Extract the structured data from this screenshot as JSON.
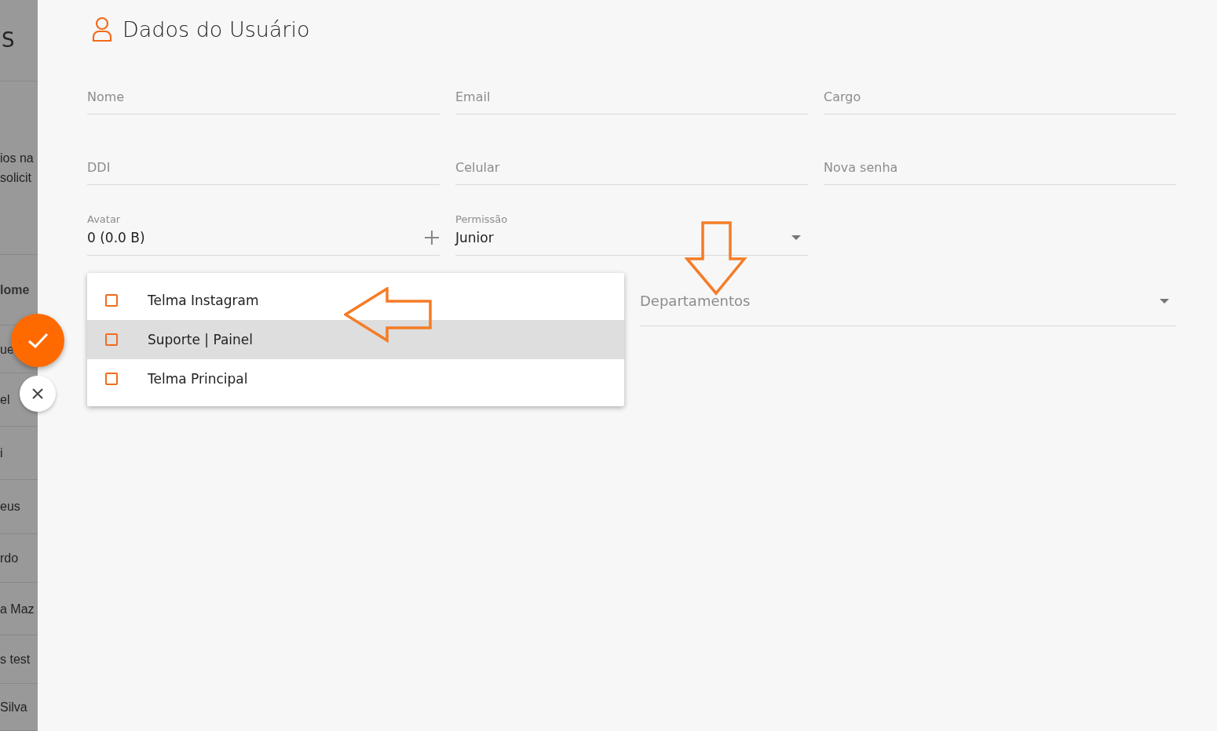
{
  "sidebar": {
    "header": "S",
    "rows": [
      {
        "lines": [
          "ios na",
          "solicit"
        ],
        "bold": false
      },
      {
        "lines": [
          "lome"
        ],
        "bold": true
      },
      {
        "lines": [
          "ue"
        ],
        "bold": false
      },
      {
        "lines": [
          "el"
        ],
        "bold": false
      },
      {
        "lines": [
          "i"
        ],
        "bold": false
      },
      {
        "lines": [
          "eus"
        ],
        "bold": false
      },
      {
        "lines": [
          "rdo"
        ],
        "bold": false
      },
      {
        "lines": [
          "a Maz"
        ],
        "bold": false
      },
      {
        "lines": [
          "s test"
        ],
        "bold": false
      },
      {
        "lines": [
          "Silva"
        ],
        "bold": false
      }
    ]
  },
  "title": "Dados do Usuário",
  "fields": [
    {
      "kind": "text",
      "label": "Nome"
    },
    {
      "kind": "text",
      "label": "Email"
    },
    {
      "kind": "text",
      "label": "Cargo"
    },
    {
      "kind": "text",
      "label": "DDI"
    },
    {
      "kind": "text",
      "label": "Celular"
    },
    {
      "kind": "text",
      "label": "Nova senha"
    },
    {
      "kind": "file",
      "label": "Avatar",
      "value": "0 (0.0 B)"
    },
    {
      "kind": "select",
      "label": "Permissão",
      "value": "Junior"
    }
  ],
  "departments": {
    "label": "Departamentos",
    "options": [
      {
        "label": "Telma Instagram",
        "checked": false,
        "highlighted": false
      },
      {
        "label": "Suporte | Painel",
        "checked": false,
        "highlighted": true
      },
      {
        "label": "Telma Principal",
        "checked": false,
        "highlighted": false
      }
    ]
  },
  "annotations": [
    {
      "kind": "left",
      "color": "#f57c26"
    },
    {
      "kind": "down",
      "color": "#f57c26"
    }
  ]
}
